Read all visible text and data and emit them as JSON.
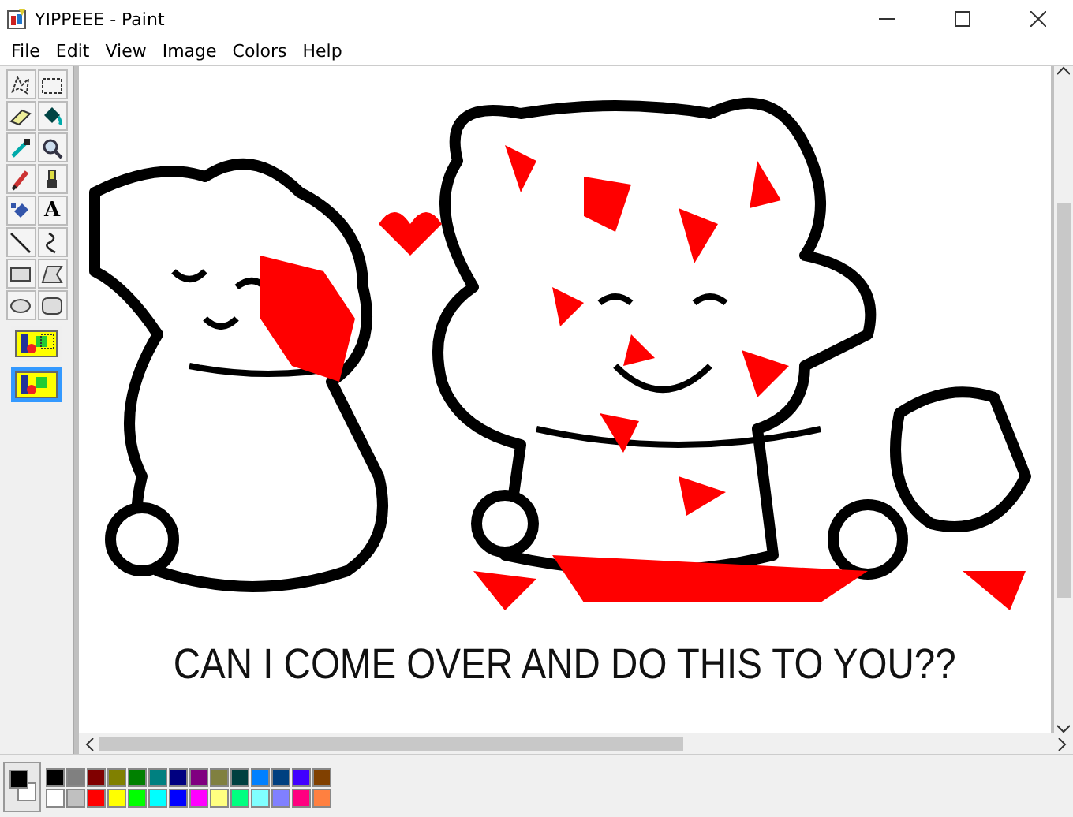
{
  "window": {
    "title": "YIPPEEE - Paint"
  },
  "menu": [
    "File",
    "Edit",
    "View",
    "Image",
    "Colors",
    "Help"
  ],
  "toolbox": {
    "text_tool_glyph": "A",
    "options": [
      {
        "selected": false
      },
      {
        "selected": true
      }
    ]
  },
  "canvas": {
    "caption": "CAN I COME OVER AND DO THIS TO YOU??"
  },
  "palette": {
    "foreground": {
      "color": "#000000"
    },
    "background": {
      "color": "#ffffff"
    },
    "colors": [
      {
        "color": "#000000"
      },
      {
        "color": "#808080"
      },
      {
        "color": "#800000"
      },
      {
        "color": "#808000"
      },
      {
        "color": "#008000"
      },
      {
        "color": "#008080"
      },
      {
        "color": "#000080"
      },
      {
        "color": "#800080"
      },
      {
        "color": "#808040"
      },
      {
        "color": "#004040"
      },
      {
        "color": "#0080ff"
      },
      {
        "color": "#004080"
      },
      {
        "color": "#4000ff"
      },
      {
        "color": "#804000"
      },
      {
        "color": "#ffffff"
      },
      {
        "color": "#c0c0c0"
      },
      {
        "color": "#ff0000"
      },
      {
        "color": "#ffff00"
      },
      {
        "color": "#00ff00"
      },
      {
        "color": "#00ffff"
      },
      {
        "color": "#0000ff"
      },
      {
        "color": "#ff00ff"
      },
      {
        "color": "#ffff80"
      },
      {
        "color": "#00ff80"
      },
      {
        "color": "#80ffff"
      },
      {
        "color": "#8080ff"
      },
      {
        "color": "#ff0080"
      },
      {
        "color": "#ff8040"
      }
    ]
  }
}
